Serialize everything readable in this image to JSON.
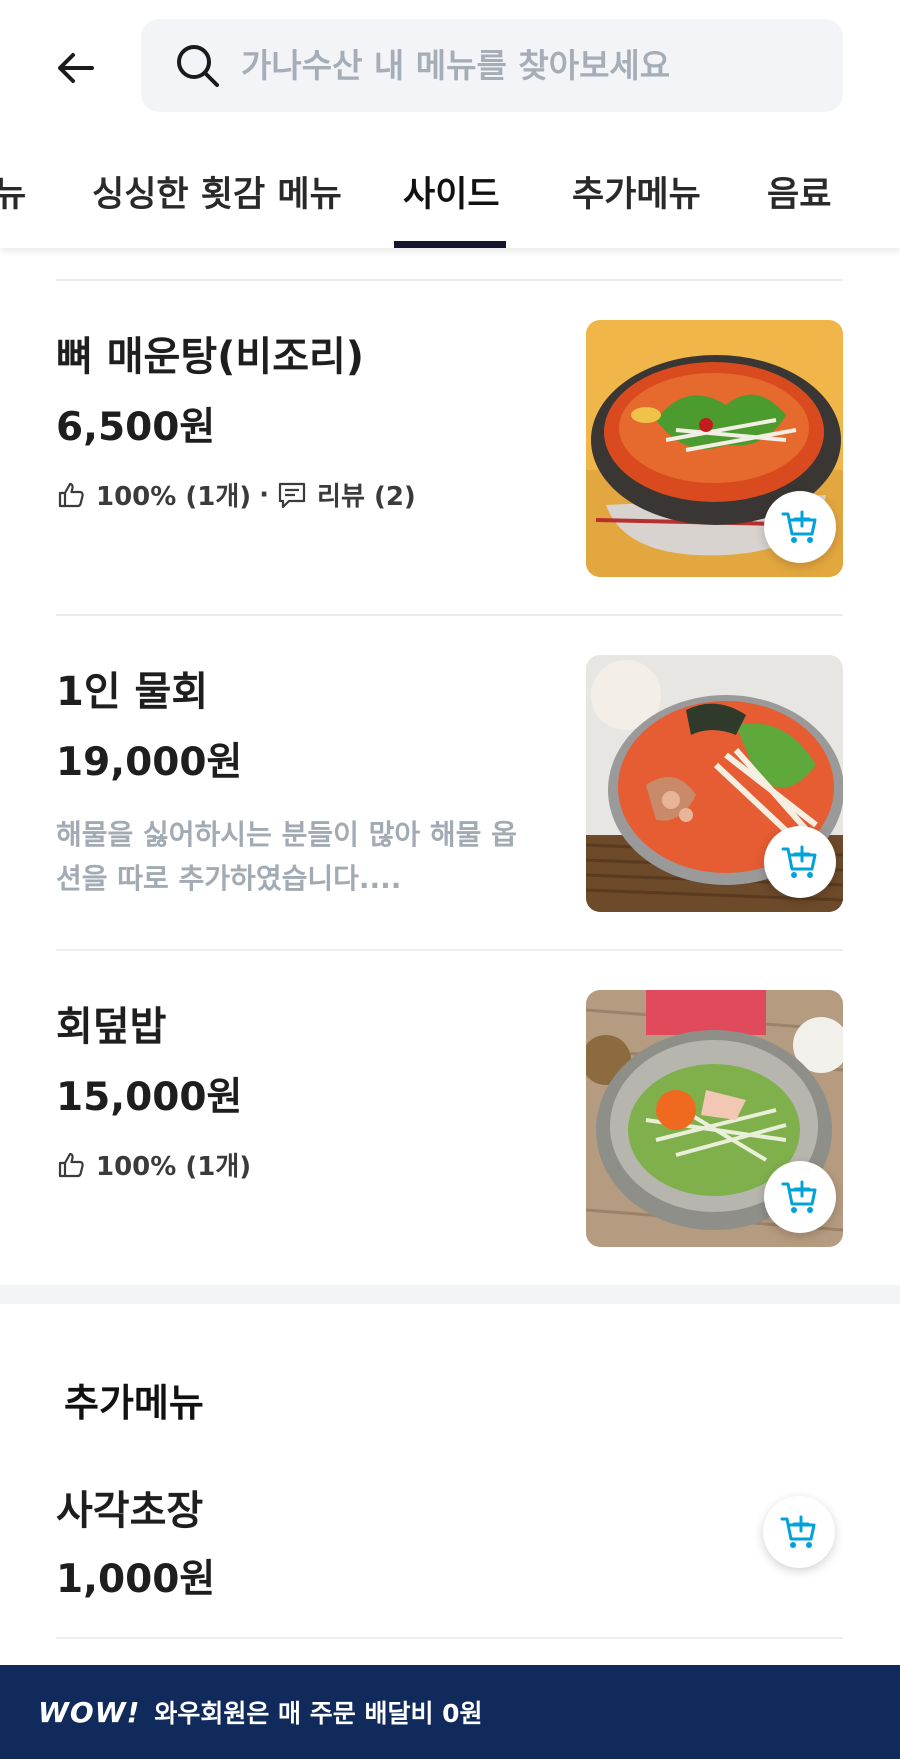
{
  "header": {
    "search_placeholder": "가나수산 내 메뉴를 찾아보세요"
  },
  "tabs": [
    {
      "label": "뉴"
    },
    {
      "label": "싱싱한 횟감 메뉴"
    },
    {
      "label": "사이드",
      "active": true
    },
    {
      "label": "추가메뉴"
    },
    {
      "label": "음료"
    }
  ],
  "items": [
    {
      "name": "뼈 매운탕(비조리)",
      "price": "6,500원",
      "like": "100% (1개)",
      "separator": "·",
      "review": "리뷰 (2)",
      "image": "spicy-fish-stew"
    },
    {
      "name": "1인 물회",
      "price": "19,000원",
      "description": "해물을 싫어하시는 분들이 많아 해물 옵션을 따로 추가하였습니다...."
    },
    {
      "name": "회덮밥",
      "price": "15,000원",
      "like": "100% (1개)"
    }
  ],
  "extra_section": {
    "title": "추가메뉴",
    "items": [
      {
        "name": "사각초장",
        "price": "1,000원"
      }
    ]
  },
  "banner": {
    "logo": "WOW!",
    "text": "와우회원은 매 주문 배달비 0원"
  },
  "colors": {
    "accent": "#00a3d9",
    "banner_bg": "#0f2a5b",
    "tab_underline": "#15152e"
  }
}
